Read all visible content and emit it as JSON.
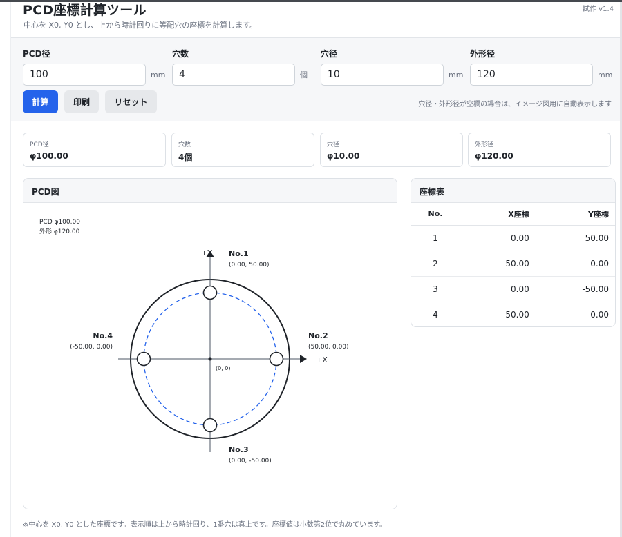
{
  "header": {
    "title": "PCD座標計算ツール",
    "subtitle": "中心を X0, Y0 とし、上から時計回りに等配穴の座標を計算します。",
    "version": "試作 v1.4"
  },
  "inputs": [
    {
      "label": "PCD径",
      "value": "100",
      "unit": "mm"
    },
    {
      "label": "穴数",
      "value": "4",
      "unit": "個"
    },
    {
      "label": "穴径",
      "value": "10",
      "unit": "mm"
    },
    {
      "label": "外形径",
      "value": "120",
      "unit": "mm"
    }
  ],
  "buttons": {
    "calc": "計算",
    "print": "印刷",
    "reset": "リセット"
  },
  "hint": "穴径・外形径が空欄の場合は、イメージ図用に自動表示します",
  "summary": [
    {
      "label": "PCD径",
      "value": "φ100.00"
    },
    {
      "label": "穴数",
      "value": "4個"
    },
    {
      "label": "穴径",
      "value": "φ10.00"
    },
    {
      "label": "外形径",
      "value": "φ120.00"
    }
  ],
  "pcd_panel": {
    "title": "PCD図",
    "legend_pcd": "PCD φ100.00",
    "legend_outer": "外形 φ120.00",
    "axis_y": "+Y",
    "axis_x": "+X",
    "origin": "(0, 0)",
    "holes": [
      {
        "name": "No.1",
        "coord": "(0.00, 50.00)"
      },
      {
        "name": "No.2",
        "coord": "(50.00, 0.00)"
      },
      {
        "name": "No.3",
        "coord": "(0.00, -50.00)"
      },
      {
        "name": "No.4",
        "coord": "(-50.00, 0.00)"
      }
    ]
  },
  "coord_table": {
    "title": "座標表",
    "columns": [
      "No.",
      "X座標",
      "Y座標"
    ],
    "rows": [
      [
        "1",
        "0.00",
        "50.00"
      ],
      [
        "2",
        "50.00",
        "0.00"
      ],
      [
        "3",
        "0.00",
        "-50.00"
      ],
      [
        "4",
        "-50.00",
        "0.00"
      ]
    ]
  },
  "footnote": "※中心を X0, Y0 とした座標です。表示順は上から時計回り、1番穴は真上です。座標値は小数第2位で丸めています。",
  "colors": {
    "accent": "#2563eb",
    "pcd_circle": "#2563eb"
  }
}
